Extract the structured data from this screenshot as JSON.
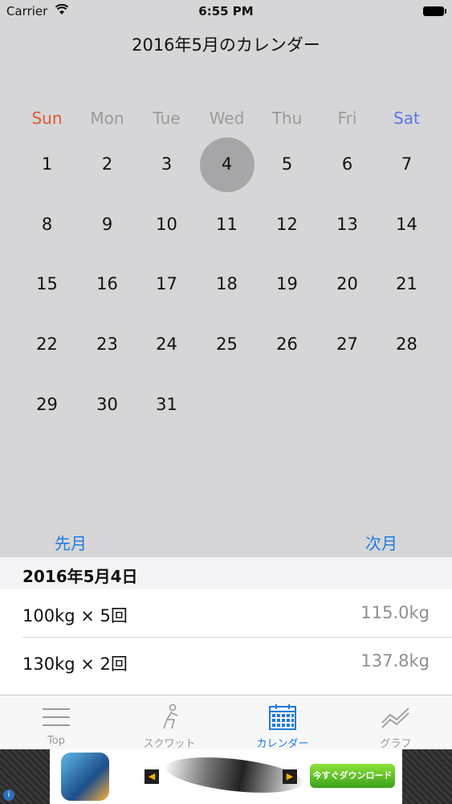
{
  "status_bar": {
    "carrier": "Carrier",
    "time": "6:55 PM"
  },
  "calendar": {
    "title": "2016年5月のカレンダー",
    "weekdays": [
      "Sun",
      "Mon",
      "Tue",
      "Wed",
      "Thu",
      "Fri",
      "Sat"
    ],
    "weekday_colors": {
      "sun": "#e0582c",
      "sat": "#5a76e8",
      "default": "#9a9a9c"
    },
    "days": [
      "1",
      "2",
      "3",
      "4",
      "5",
      "6",
      "7",
      "8",
      "9",
      "10",
      "11",
      "12",
      "13",
      "14",
      "15",
      "16",
      "17",
      "18",
      "19",
      "20",
      "21",
      "22",
      "23",
      "24",
      "25",
      "26",
      "27",
      "28",
      "29",
      "30",
      "31"
    ],
    "selected_day": "4",
    "prev_label": "先月",
    "next_label": "次月"
  },
  "records": {
    "date_header": "2016年5月4日",
    "items": [
      {
        "left": "100kg × 5回",
        "right": "115.0kg"
      },
      {
        "left": "130kg × 2回",
        "right": "137.8kg"
      }
    ]
  },
  "tabbar": {
    "tabs": [
      {
        "label": "Top",
        "icon": "menu-icon"
      },
      {
        "label": "スクワット",
        "icon": "squat-figure-icon"
      },
      {
        "label": "カレンダー",
        "icon": "calendar-icon"
      },
      {
        "label": "グラフ",
        "icon": "graph-icon"
      }
    ],
    "active_tab": "カレンダー",
    "accent_color": "#1f7ae0"
  },
  "ad": {
    "button_label": "今すぐダウンロード",
    "info_symbol": "i"
  }
}
